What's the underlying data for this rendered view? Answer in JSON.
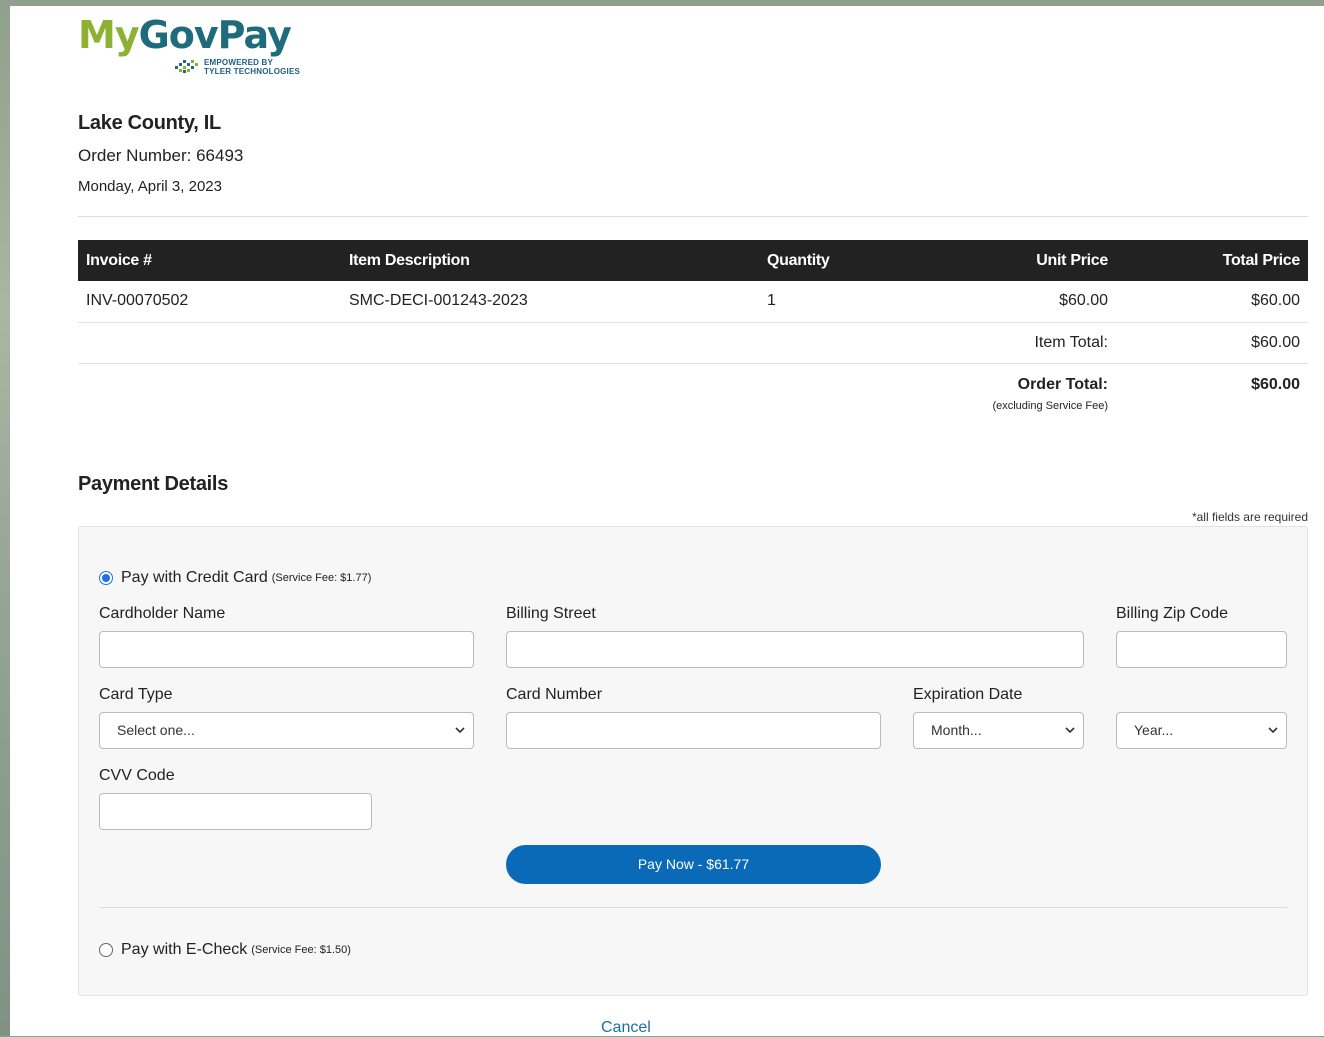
{
  "brand": {
    "logo_my": "My",
    "logo_gov": "GovPay",
    "empowered_line1": "EMPOWERED BY",
    "empowered_line2": "TYLER TECHNOLOGIES"
  },
  "order": {
    "county": "Lake County, IL",
    "order_number": "Order Number: 66493",
    "date": "Monday, April 3, 2023"
  },
  "table": {
    "headers": [
      "Invoice #",
      "Item Description",
      "Quantity",
      "Unit Price",
      "Total Price"
    ],
    "rows": [
      {
        "invoice": "INV-00070502",
        "description": "SMC-DECI-001243-2023",
        "quantity": "1",
        "unit_price": "$60.00",
        "total_price": "$60.00"
      }
    ],
    "item_total_label": "Item Total:",
    "item_total_value": "$60.00",
    "order_total_label": "Order Total:",
    "order_total_note": "(excluding Service Fee)",
    "order_total_value": "$60.00"
  },
  "payment": {
    "title": "Payment Details",
    "required_note": "*all fields are required",
    "credit_card": {
      "label": "Pay with Credit Card",
      "fee": "(Service Fee: $1.77)",
      "selected": true
    },
    "fields": {
      "cardholder_name": "Cardholder Name",
      "billing_street": "Billing Street",
      "billing_zip": "Billing Zip Code",
      "card_type": "Card Type",
      "card_type_value": "Select one...",
      "card_number": "Card Number",
      "expiration_date": "Expiration Date",
      "month_value": "Month...",
      "year_value": "Year...",
      "cvv": "CVV Code"
    },
    "pay_button": "Pay Now - $61.77",
    "echeck": {
      "label": "Pay with E-Check",
      "fee": "(Service Fee: $1.50)",
      "selected": false
    },
    "accent_color": "#0a6ab8"
  },
  "cancel_label": "Cancel"
}
